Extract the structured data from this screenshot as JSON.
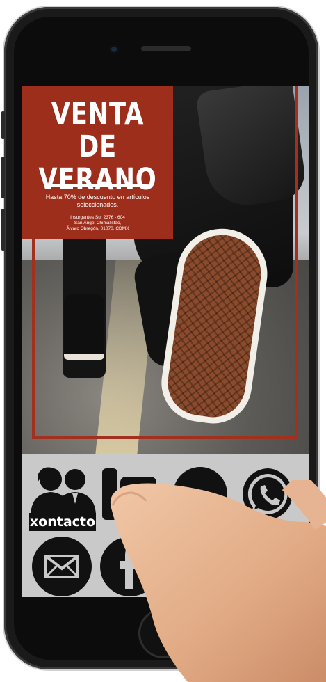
{
  "promo": {
    "title_line1": "VENTA DE",
    "title_line2": "VERANO",
    "subtitle": "Hasta 70% de descuento en artículos seleccionados.",
    "address_line1": "Insurgentes Sur 2376 - 604",
    "address_line2": "San Ángel Chimalistac,",
    "address_line3": "Álvaro Obregón, 01070, CDMX"
  },
  "icons": {
    "contact_label": "xontacto",
    "items": [
      "contact-icon",
      "phone-icon",
      "chat-icon",
      "whatsapp-icon",
      "email-icon",
      "facebook-icon",
      "instagram-icon"
    ]
  },
  "colors": {
    "promo_red": "#9e2e1c",
    "icon_bar": "#c9c9c9",
    "icon_fill": "#111111"
  }
}
